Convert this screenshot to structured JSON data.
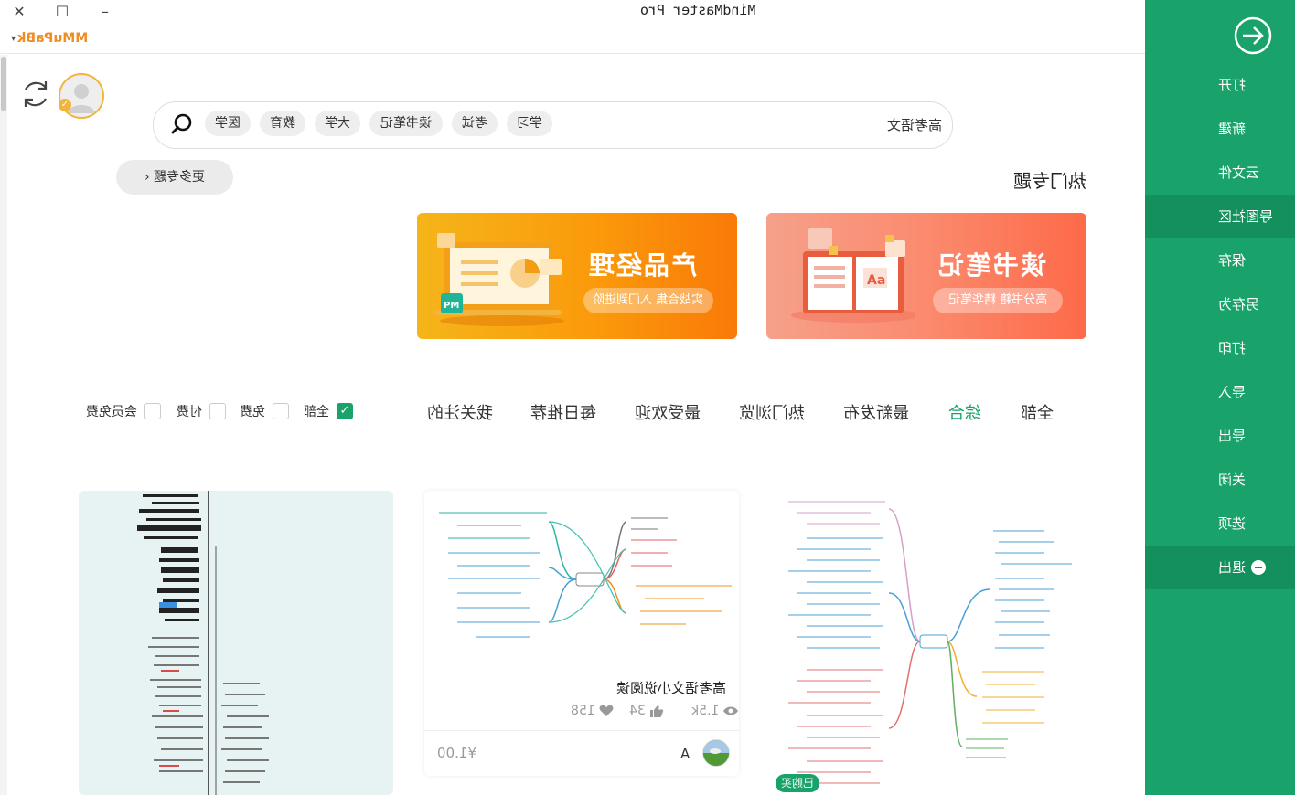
{
  "window": {
    "title": "MindMaster Pro",
    "user_name": "MMuPaBk"
  },
  "search": {
    "value": "高考语文",
    "tags": [
      "学习",
      "考试",
      "读书笔记",
      "大学",
      "教育",
      "医学"
    ]
  },
  "hot_topics": {
    "title": "热门专题",
    "more_label": "更多专题",
    "banners": [
      {
        "title": "读书笔记",
        "subtitle": "高分书籍 精华笔记"
      },
      {
        "title": "产品经理",
        "subtitle": "实战合集 入门到进阶",
        "badge": "PM"
      }
    ]
  },
  "category_tabs": [
    {
      "label": "全部",
      "active": false
    },
    {
      "label": "综合",
      "active": true
    },
    {
      "label": "最新发布",
      "active": false
    },
    {
      "label": "热门浏览",
      "active": false
    },
    {
      "label": "最受欢迎",
      "active": false
    },
    {
      "label": "每日推荐",
      "active": false
    },
    {
      "label": "我关注的",
      "active": false
    }
  ],
  "filters": [
    {
      "label": "全部",
      "checked": true
    },
    {
      "label": "免费",
      "checked": false
    },
    {
      "label": "付费",
      "checked": false
    },
    {
      "label": "会员免费",
      "checked": false
    }
  ],
  "cards": [
    {
      "id": "card-3",
      "badge": "已购买"
    },
    {
      "id": "card-2",
      "title": "高考语文小说阅读",
      "views": "1.5k",
      "likes": "34",
      "favorites": "158",
      "author": "A",
      "price": "¥1.00"
    }
  ],
  "sidebar": {
    "items": [
      {
        "label": "打开"
      },
      {
        "label": "新建"
      },
      {
        "label": "云文件"
      },
      {
        "label": "导图社区",
        "active": true
      },
      {
        "label": "保存"
      },
      {
        "label": "另存为"
      },
      {
        "label": "打印"
      },
      {
        "label": "导入"
      },
      {
        "label": "导出"
      },
      {
        "label": "关闭"
      },
      {
        "label": "选项"
      },
      {
        "label": "退出"
      }
    ]
  },
  "colors": {
    "accent": "#19a36a",
    "sidebar_active": "#14905c",
    "user_name": "#f08c24",
    "avatar_ring": "#f2b53c",
    "banner_pm": "#f98a0b",
    "banner_read": "#fd7458"
  }
}
